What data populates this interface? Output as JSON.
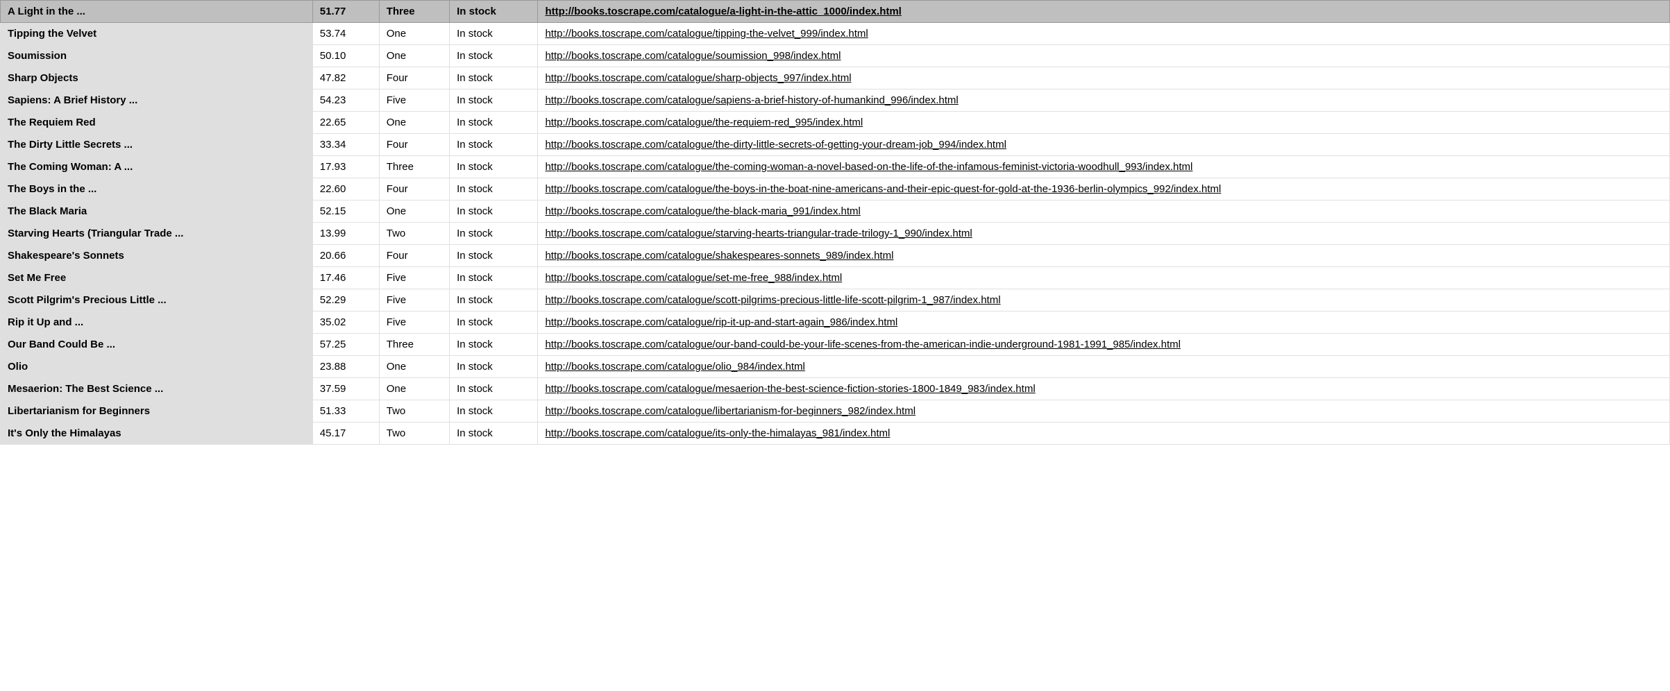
{
  "header": {
    "title": "A Light in the ...",
    "price": "51.77",
    "rating": "Three",
    "stock": "In stock",
    "url": "http://books.toscrape.com/catalogue/a-light-in-the-attic_1000/index.html"
  },
  "rows": [
    {
      "title": "Tipping the Velvet",
      "price": "53.74",
      "rating": "One",
      "stock": "In stock",
      "url": "http://books.toscrape.com/catalogue/tipping-the-velvet_999/index.html"
    },
    {
      "title": "Soumission",
      "price": "50.10",
      "rating": "One",
      "stock": "In stock",
      "url": "http://books.toscrape.com/catalogue/soumission_998/index.html"
    },
    {
      "title": "Sharp Objects",
      "price": "47.82",
      "rating": "Four",
      "stock": "In stock",
      "url": "http://books.toscrape.com/catalogue/sharp-objects_997/index.html"
    },
    {
      "title": "Sapiens: A Brief History ...",
      "price": "54.23",
      "rating": "Five",
      "stock": "In stock",
      "url": "http://books.toscrape.com/catalogue/sapiens-a-brief-history-of-humankind_996/index.html"
    },
    {
      "title": "The Requiem Red",
      "price": "22.65",
      "rating": "One",
      "stock": "In stock",
      "url": "http://books.toscrape.com/catalogue/the-requiem-red_995/index.html"
    },
    {
      "title": "The Dirty Little Secrets ...",
      "price": "33.34",
      "rating": "Four",
      "stock": "In stock",
      "url": "http://books.toscrape.com/catalogue/the-dirty-little-secrets-of-getting-your-dream-job_994/index.html"
    },
    {
      "title": "The Coming Woman: A ...",
      "price": "17.93",
      "rating": "Three",
      "stock": "In stock",
      "url": "http://books.toscrape.com/catalogue/the-coming-woman-a-novel-based-on-the-life-of-the-infamous-feminist-victoria-woodhull_993/index.html"
    },
    {
      "title": "The Boys in the ...",
      "price": "22.60",
      "rating": "Four",
      "stock": "In stock",
      "url": "http://books.toscrape.com/catalogue/the-boys-in-the-boat-nine-americans-and-their-epic-quest-for-gold-at-the-1936-berlin-olympics_992/index.html"
    },
    {
      "title": "The Black Maria",
      "price": "52.15",
      "rating": "One",
      "stock": "In stock",
      "url": "http://books.toscrape.com/catalogue/the-black-maria_991/index.html"
    },
    {
      "title": "Starving Hearts (Triangular Trade ...",
      "price": "13.99",
      "rating": "Two",
      "stock": "In stock",
      "url": "http://books.toscrape.com/catalogue/starving-hearts-triangular-trade-trilogy-1_990/index.html"
    },
    {
      "title": "Shakespeare's Sonnets",
      "price": "20.66",
      "rating": "Four",
      "stock": "In stock",
      "url": "http://books.toscrape.com/catalogue/shakespeares-sonnets_989/index.html"
    },
    {
      "title": "Set Me Free",
      "price": "17.46",
      "rating": "Five",
      "stock": "In stock",
      "url": "http://books.toscrape.com/catalogue/set-me-free_988/index.html"
    },
    {
      "title": "Scott Pilgrim's Precious Little ...",
      "price": "52.29",
      "rating": "Five",
      "stock": "In stock",
      "url": "http://books.toscrape.com/catalogue/scott-pilgrims-precious-little-life-scott-pilgrim-1_987/index.html"
    },
    {
      "title": "Rip it Up and ...",
      "price": "35.02",
      "rating": "Five",
      "stock": "In stock",
      "url": "http://books.toscrape.com/catalogue/rip-it-up-and-start-again_986/index.html"
    },
    {
      "title": "Our Band Could Be ...",
      "price": "57.25",
      "rating": "Three",
      "stock": "In stock",
      "url": "http://books.toscrape.com/catalogue/our-band-could-be-your-life-scenes-from-the-american-indie-underground-1981-1991_985/index.html"
    },
    {
      "title": "Olio",
      "price": "23.88",
      "rating": "One",
      "stock": "In stock",
      "url": "http://books.toscrape.com/catalogue/olio_984/index.html"
    },
    {
      "title": "Mesaerion: The Best Science ...",
      "price": "37.59",
      "rating": "One",
      "stock": "In stock",
      "url": "http://books.toscrape.com/catalogue/mesaerion-the-best-science-fiction-stories-1800-1849_983/index.html"
    },
    {
      "title": "Libertarianism for Beginners",
      "price": "51.33",
      "rating": "Two",
      "stock": "In stock",
      "url": "http://books.toscrape.com/catalogue/libertarianism-for-beginners_982/index.html"
    },
    {
      "title": "It's Only the Himalayas",
      "price": "45.17",
      "rating": "Two",
      "stock": "In stock",
      "url": "http://books.toscrape.com/catalogue/its-only-the-himalayas_981/index.html"
    }
  ]
}
